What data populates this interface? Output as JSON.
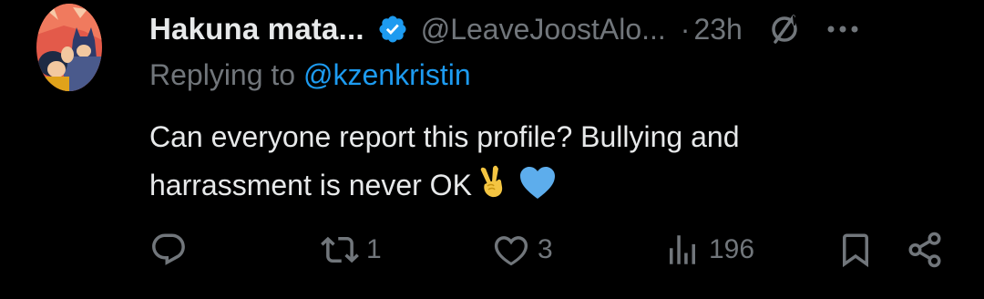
{
  "tweet": {
    "author": {
      "display_name": "Hakuna mata...",
      "handle": "@LeaveJoostAlo...",
      "verified": true
    },
    "separator": "·",
    "timestamp": "23h",
    "replying_prefix": "Replying to",
    "replying_to": "@kzenkristin",
    "text_lines": [
      "Can everyone report this profile? Bullying and",
      "harrassment is never OK"
    ],
    "emojis": [
      "victory-hand",
      "blue-heart"
    ]
  },
  "actions": {
    "reply_count": "",
    "retweet_count": "1",
    "like_count": "3",
    "views_count": "196"
  },
  "colors": {
    "background": "#000000",
    "primary_text": "#e7e9ea",
    "secondary_text": "#71767b",
    "accent": "#1d9bf0"
  }
}
